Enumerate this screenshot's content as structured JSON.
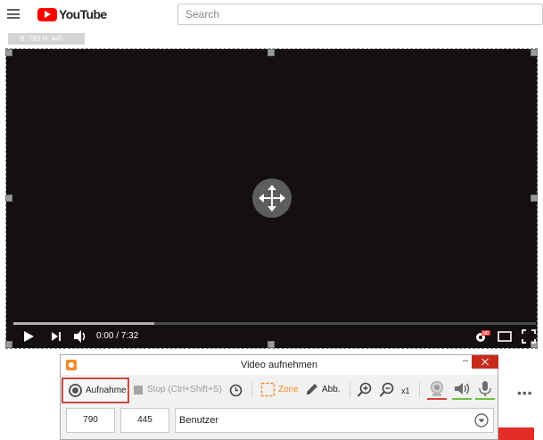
{
  "browser_page": {
    "logo_text": "YouTube",
    "search_placeholder": "Search",
    "more_dots": "•••"
  },
  "capture_area": {
    "size_label": "B: 790 H: 445",
    "video": {
      "time_display": "0:00 / 7:32",
      "progress": 0.27
    }
  },
  "recorder": {
    "title": "Video aufnehmen",
    "record_label": "Aufnahme",
    "stop_label": "Stop (Ctrl+Shift+S)",
    "zone_label": "Zone",
    "draw_label": "Abb.",
    "zoom_label": "x1",
    "width_value": "790",
    "height_value": "445",
    "preset_value": "Benutzer",
    "colors": {
      "accent": "#f18b2a",
      "record_border": "#c64b43",
      "close": "#c42b1c",
      "webcam_underline": "#d9433a",
      "audio_underline": "#6fbf3f"
    }
  }
}
